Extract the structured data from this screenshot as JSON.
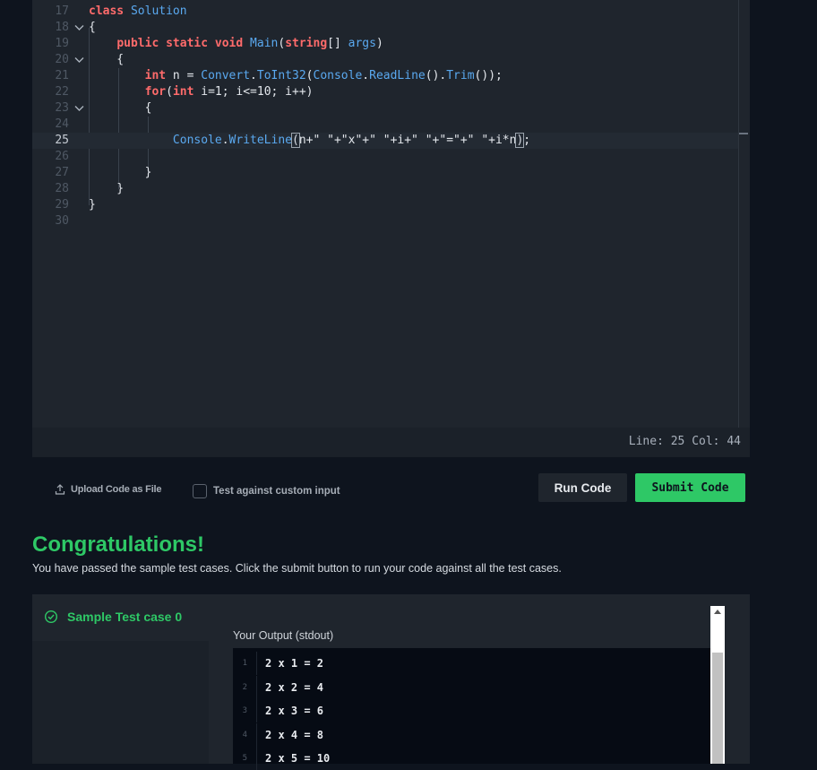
{
  "editor": {
    "lines": [
      {
        "num": "17",
        "fold": false,
        "tokens": [
          [
            "kw",
            "class"
          ],
          [
            "pl",
            " "
          ],
          [
            "cls",
            "Solution"
          ]
        ]
      },
      {
        "num": "18",
        "fold": true,
        "tokens": [
          [
            "pl",
            "{"
          ]
        ]
      },
      {
        "num": "19",
        "fold": false,
        "tokens": [
          [
            "pl",
            "    "
          ],
          [
            "kw",
            "public"
          ],
          [
            "pl",
            " "
          ],
          [
            "kw",
            "static"
          ],
          [
            "pl",
            " "
          ],
          [
            "kw",
            "void"
          ],
          [
            "pl",
            " "
          ],
          [
            "fn",
            "Main"
          ],
          [
            "pl",
            "("
          ],
          [
            "kw",
            "string"
          ],
          [
            "pl",
            "[] "
          ],
          [
            "cls",
            "args"
          ],
          [
            "pl",
            ")"
          ]
        ]
      },
      {
        "num": "20",
        "fold": true,
        "tokens": [
          [
            "pl",
            "    {"
          ]
        ]
      },
      {
        "num": "21",
        "fold": false,
        "tokens": [
          [
            "pl",
            "        "
          ],
          [
            "kw",
            "int"
          ],
          [
            "pl",
            " n = "
          ],
          [
            "cls",
            "Convert"
          ],
          [
            "pl",
            "."
          ],
          [
            "fn",
            "ToInt32"
          ],
          [
            "pl",
            "("
          ],
          [
            "cls",
            "Console"
          ],
          [
            "pl",
            "."
          ],
          [
            "fn",
            "ReadLine"
          ],
          [
            "pl",
            "()."
          ],
          [
            "fn",
            "Trim"
          ],
          [
            "pl",
            "());"
          ]
        ]
      },
      {
        "num": "22",
        "fold": false,
        "tokens": [
          [
            "pl",
            "        "
          ],
          [
            "kw",
            "for"
          ],
          [
            "pl",
            "("
          ],
          [
            "kw",
            "int"
          ],
          [
            "pl",
            " i=1; i<=10; i++)"
          ]
        ]
      },
      {
        "num": "23",
        "fold": true,
        "tokens": [
          [
            "pl",
            "        {"
          ]
        ]
      },
      {
        "num": "24",
        "fold": false,
        "tokens": []
      },
      {
        "num": "25",
        "fold": false,
        "current": true,
        "tokens": [
          [
            "pl",
            "            "
          ],
          [
            "cls",
            "Console"
          ],
          [
            "pl",
            "."
          ],
          [
            "fn",
            "WriteLine"
          ],
          [
            "bracket",
            "("
          ],
          [
            "pl",
            "n+\" \"+\"x\"+\" \"+i+\" \"+\"=\"+\" \"+i*n"
          ],
          [
            "bracket",
            ")"
          ],
          [
            "pl",
            ";"
          ]
        ]
      },
      {
        "num": "26",
        "fold": false,
        "tokens": []
      },
      {
        "num": "27",
        "fold": false,
        "tokens": [
          [
            "pl",
            "        }"
          ]
        ]
      },
      {
        "num": "28",
        "fold": false,
        "tokens": [
          [
            "pl",
            "    }"
          ]
        ]
      },
      {
        "num": "29",
        "fold": false,
        "tokens": [
          [
            "pl",
            "}"
          ]
        ]
      },
      {
        "num": "30",
        "fold": false,
        "tokens": []
      }
    ],
    "status": "Line: 25 Col: 44"
  },
  "actions": {
    "upload_label": "Upload Code as File",
    "custom_input_label": "Test against custom input",
    "run_label": "Run Code",
    "submit_label": "Submit Code"
  },
  "result": {
    "heading": "Congratulations!",
    "message": "You have passed the sample test cases. Click the submit button to run your code against all the test cases.",
    "case_title": "Sample Test case 0",
    "output_label": "Your Output (stdout)",
    "output_lines": [
      {
        "num": "1",
        "text": "2 x 1 = 2"
      },
      {
        "num": "2",
        "text": "2 x 2 = 4"
      },
      {
        "num": "3",
        "text": "2 x 3 = 6"
      },
      {
        "num": "4",
        "text": "2 x 4 = 8"
      },
      {
        "num": "5",
        "text": "2 x 5 = 10"
      }
    ]
  },
  "colors": {
    "accent_green": "#2ec866",
    "keyword_red": "#ff6b6b",
    "identifier_blue": "#5aa9f0",
    "background": "#0e141e"
  },
  "icons": {
    "upload": "upload-icon",
    "check": "check-circle-icon",
    "fold": "chevron-down-icon"
  }
}
